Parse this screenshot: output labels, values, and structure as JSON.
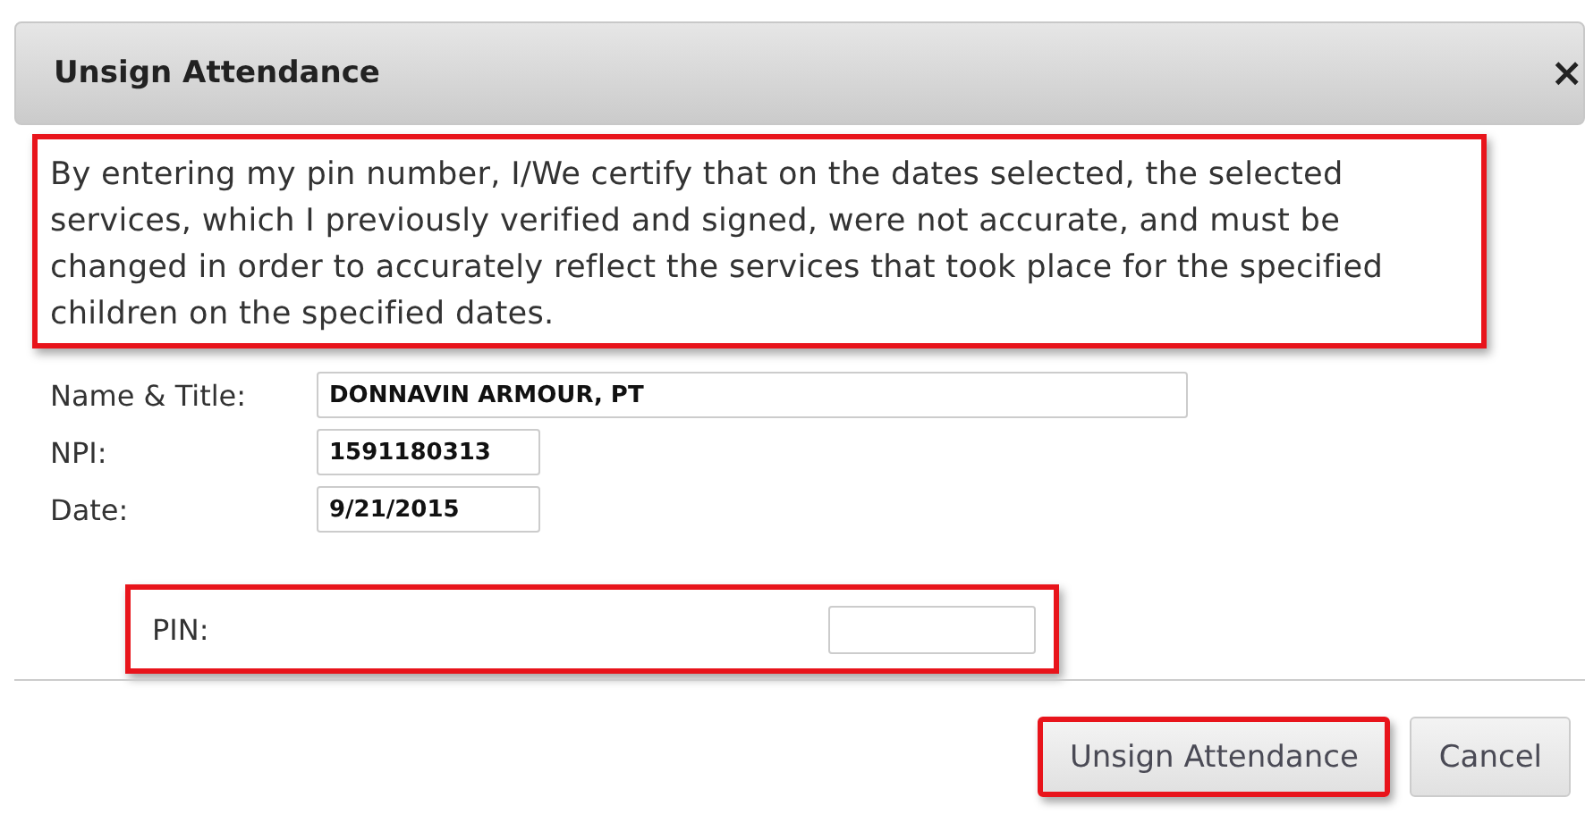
{
  "dialog": {
    "title": "Unsign Attendance",
    "close": "×"
  },
  "statement": "By entering my pin number, I/We certify that on the dates selected, the selected services, which I previously verified and signed, were not accurate, and must be changed in order to accurately reflect the services that took place for the specified children on the specified dates.",
  "fields": [
    {
      "label": "Name & Title:",
      "value": "DONNAVIN ARMOUR, PT"
    },
    {
      "label": "NPI:",
      "value": "1591180313"
    },
    {
      "label": "Date:",
      "value": "9/21/2015"
    }
  ],
  "pin": {
    "label": "PIN:"
  },
  "buttons": [
    {
      "label": "Unsign Attendance",
      "highlighted": true
    },
    {
      "label": "Cancel",
      "highlighted": false
    }
  ]
}
